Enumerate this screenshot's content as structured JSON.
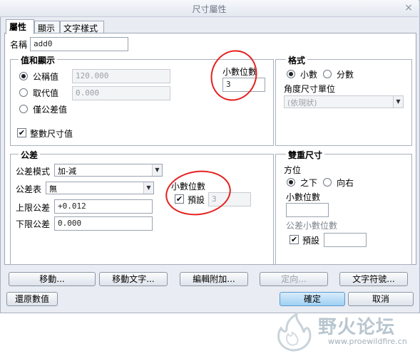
{
  "window": {
    "title": "尺寸屬性",
    "close_glyph": "×"
  },
  "tabs": [
    {
      "label": "屬性",
      "active": true
    },
    {
      "label": "顯示",
      "active": false
    },
    {
      "label": "文字樣式",
      "active": false
    }
  ],
  "name_field": {
    "label": "名稱",
    "value": "add0"
  },
  "value_display": {
    "legend": "值和顯示",
    "nominal": {
      "label": "公稱值",
      "value": "120.000",
      "selected": true
    },
    "override": {
      "label": "取代值",
      "value": "0.000",
      "selected": false
    },
    "tolerance_only": {
      "label": "僅公差值",
      "selected": false
    },
    "integer_value": {
      "label": "整數尺寸值",
      "checked": true
    },
    "decimals": {
      "label": "小數位數",
      "value": "3"
    }
  },
  "format": {
    "legend": "格式",
    "decimal": {
      "label": "小數",
      "selected": true
    },
    "fraction": {
      "label": "分數",
      "selected": false
    },
    "angular_unit_label": "角度尺寸單位",
    "angular_unit_value": "(依現狀)"
  },
  "tolerance": {
    "legend": "公差",
    "mode_label": "公差模式",
    "mode_value": "加-減",
    "table_label": "公差表",
    "table_value": "無",
    "upper_label": "上限公差",
    "upper_value": "+0.012",
    "lower_label": "下限公差",
    "lower_value": "0.000",
    "decimals_label": "小數位數",
    "default_label": "預設",
    "default_checked": true,
    "default_value": "3"
  },
  "dual_dimension": {
    "legend": "雙重尺寸",
    "position_label": "方位",
    "below": {
      "label": "之下",
      "selected": true
    },
    "right": {
      "label": "向右",
      "selected": false
    },
    "decimals_label": "小數位數",
    "decimals_value": "",
    "tol_decimals_label": "公差小數位數",
    "default_label": "預設",
    "default_checked": true,
    "default_value": ""
  },
  "action_buttons": {
    "move": "移動...",
    "move_text": "移動文字...",
    "edit_attach": "編輯附加...",
    "orient": "定向...",
    "text_symbol": "文字符號..."
  },
  "footer": {
    "restore": "還原數值",
    "ok": "確定",
    "cancel": "取消"
  },
  "watermark": {
    "text": "野火论坛",
    "url": "www.proewildfire.cn"
  },
  "colors": {
    "annotation": "#e5201f",
    "primary_button": "#9fd0f3",
    "watermark": "#b8c6cf"
  },
  "checkmark": "✔",
  "dropdown_arrow": "▼"
}
